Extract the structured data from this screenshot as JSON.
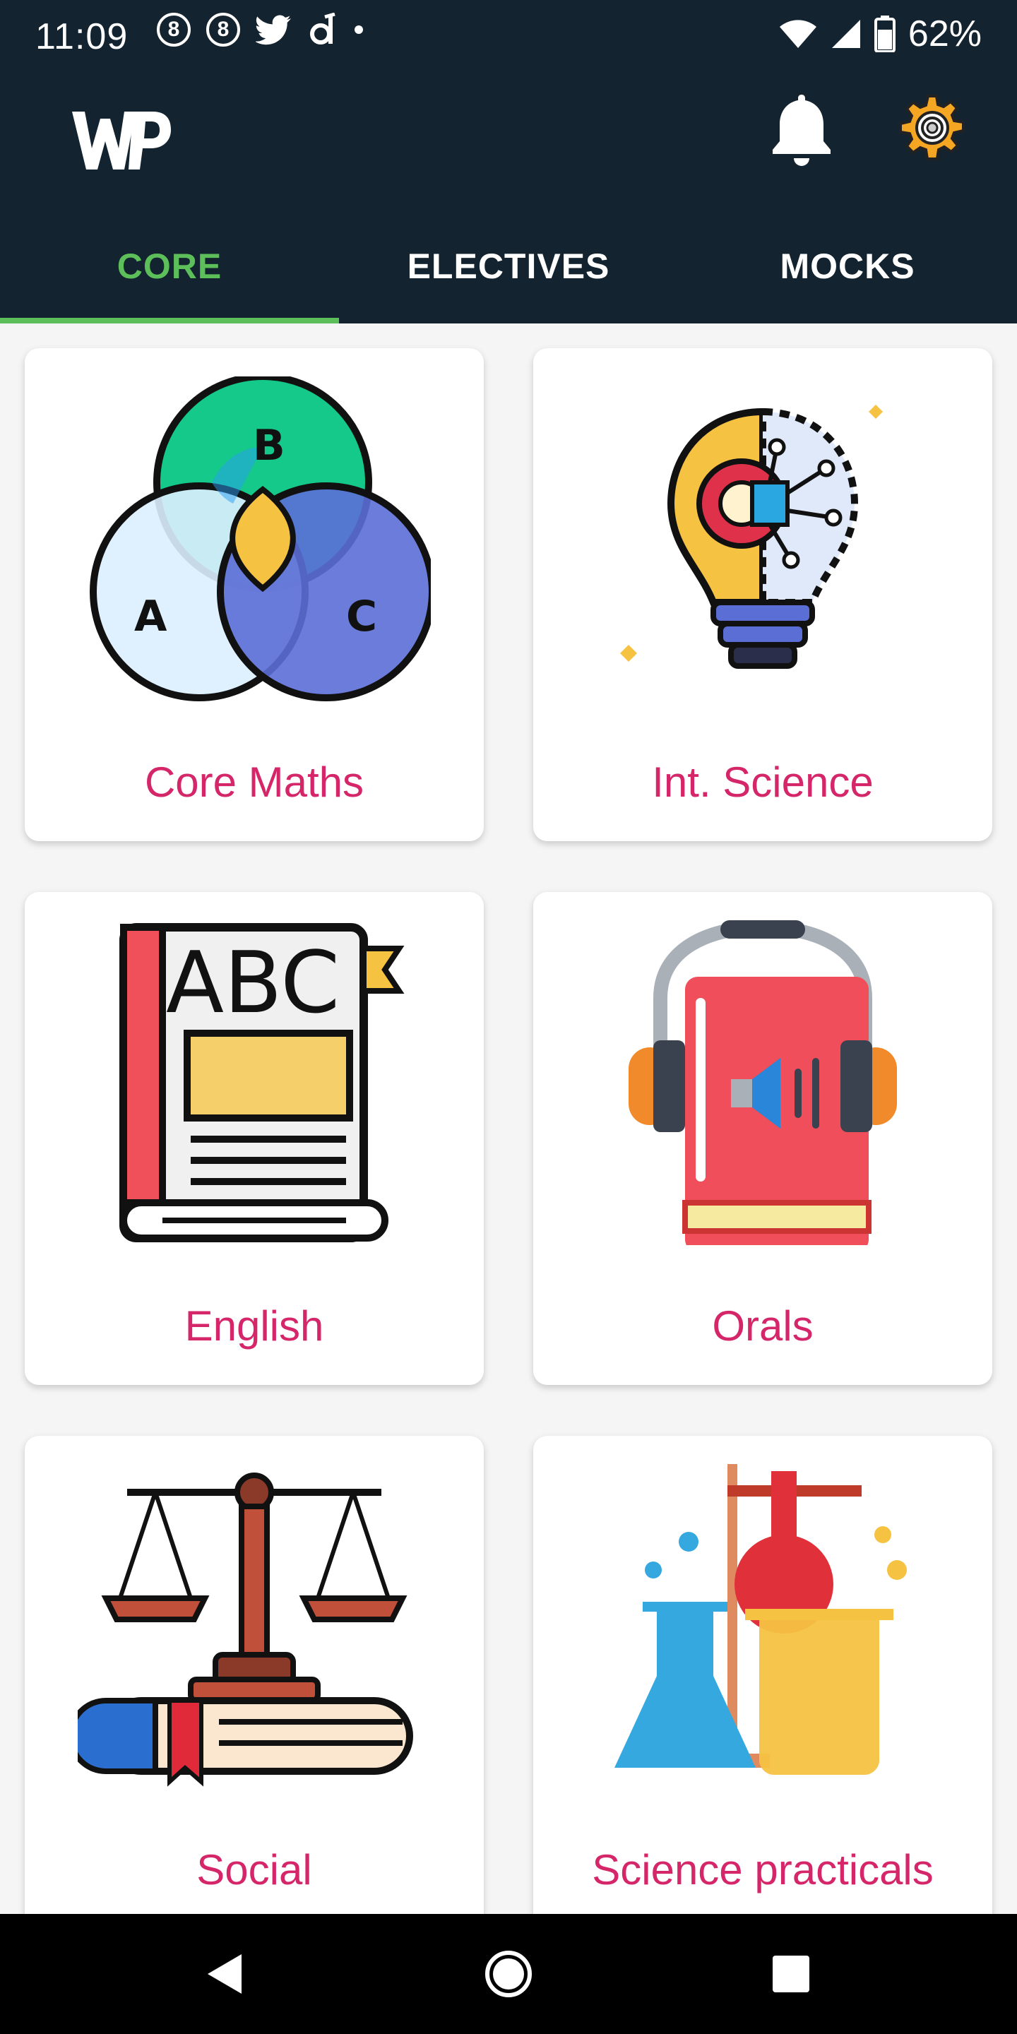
{
  "status_bar": {
    "time": "11:09",
    "notification_icons": [
      "circle-8-icon",
      "circle-8-icon",
      "twitter-icon",
      "d-app-icon",
      "dot-icon"
    ],
    "battery_percent": "62%"
  },
  "app_bar": {
    "logo_text": "WP",
    "icons": [
      "bell-icon",
      "gear-icon"
    ]
  },
  "tabs": [
    {
      "label": "CORE",
      "active": true
    },
    {
      "label": "ELECTIVES",
      "active": false
    },
    {
      "label": "MOCKS",
      "active": false
    }
  ],
  "subjects": [
    {
      "label": "Core Maths",
      "icon": "venn-diagram-icon"
    },
    {
      "label": "Int. Science",
      "icon": "lightbulb-gear-icon"
    },
    {
      "label": "English",
      "icon": "abc-book-icon"
    },
    {
      "label": "Orals",
      "icon": "audio-book-headphones-icon"
    },
    {
      "label": "Social",
      "icon": "scales-of-justice-icon"
    },
    {
      "label": "Science practicals",
      "icon": "lab-flasks-icon"
    }
  ],
  "colors": {
    "app_bar": "#13232f",
    "active_tab": "#5cbf5a",
    "card_label": "#d6266a"
  }
}
